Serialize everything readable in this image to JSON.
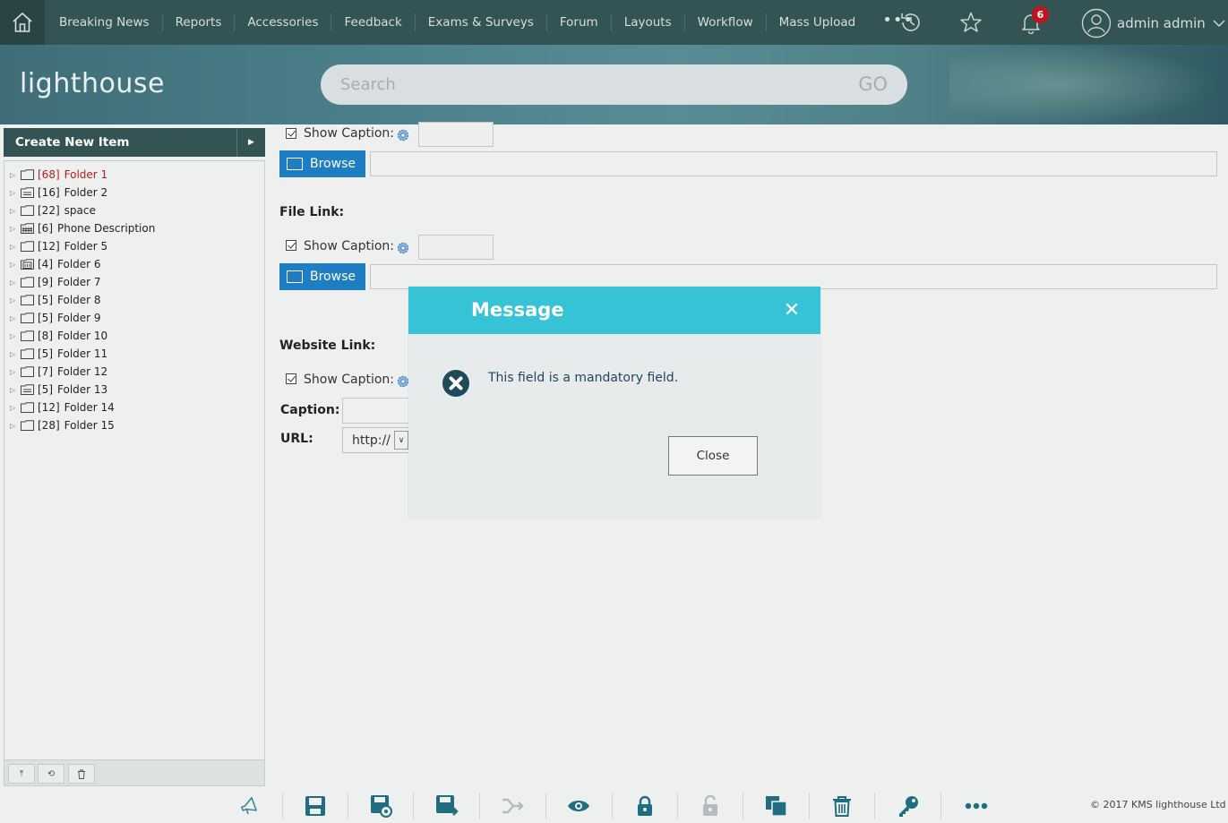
{
  "nav": {
    "items": [
      "Breaking News",
      "Reports",
      "Accessories",
      "Feedback",
      "Exams & Surveys",
      "Forum",
      "Layouts",
      "Workflow",
      "Mass Upload"
    ],
    "more": "•••",
    "notification_count": "6",
    "user_name": "admin admin"
  },
  "header": {
    "logo_text": "lighthouse",
    "search_placeholder": "Search",
    "search_go": "GO"
  },
  "sidebar": {
    "create_label": "Create New Item",
    "tree": [
      {
        "count": "[68]",
        "label": "Folder 1",
        "icon": "folder-icon",
        "active": true
      },
      {
        "count": "[16]",
        "label": "Folder 2",
        "icon": "calendar-folder-icon",
        "active": false
      },
      {
        "count": "[22]",
        "label": "space",
        "icon": "folder-icon",
        "active": false
      },
      {
        "count": "[6]",
        "label": "Phone Description",
        "icon": "grid-folder-icon",
        "active": false
      },
      {
        "count": "[12]",
        "label": "Folder 5",
        "icon": "folder-icon",
        "active": false
      },
      {
        "count": "[4]",
        "label": "Folder 6",
        "icon": "building-folder-icon",
        "active": false
      },
      {
        "count": "[9]",
        "label": "Folder 7",
        "icon": "folder-icon",
        "active": false
      },
      {
        "count": "[5]",
        "label": "Folder 8",
        "icon": "folder-icon",
        "active": false
      },
      {
        "count": "[5]",
        "label": "Folder 9",
        "icon": "folder-icon",
        "active": false
      },
      {
        "count": "[8]",
        "label": "Folder 10",
        "icon": "folder-icon",
        "active": false
      },
      {
        "count": "[5]",
        "label": "Folder 11",
        "icon": "folder-icon",
        "active": false
      },
      {
        "count": "[7]",
        "label": "Folder 12",
        "icon": "folder-icon",
        "active": false
      },
      {
        "count": "[5]",
        "label": "Folder 13",
        "icon": "calendar-folder-icon",
        "active": false
      },
      {
        "count": "[12]",
        "label": "Folder 14",
        "icon": "folder-icon",
        "active": false
      },
      {
        "count": "[28]",
        "label": "Folder 15",
        "icon": "folder-icon",
        "active": false
      }
    ]
  },
  "form": {
    "show_caption": "Show Caption:",
    "browse": "Browse",
    "file_link": "File Link:",
    "website_link": "Website Link:",
    "caption": "Caption:",
    "url": "URL:",
    "url_protocol": "http://"
  },
  "modal": {
    "title": "Message",
    "message": "This field is a mandatory field.",
    "close": "Close"
  },
  "footer": {
    "copyright": "© 2017 KMS lighthouse Ltd"
  },
  "colors": {
    "nav_bg": "#335355",
    "modal_header": "#35c3d5",
    "browse_btn": "#1f7ec1",
    "error_icon": "#1f4a5c",
    "active_tree": "#c01a1a"
  }
}
